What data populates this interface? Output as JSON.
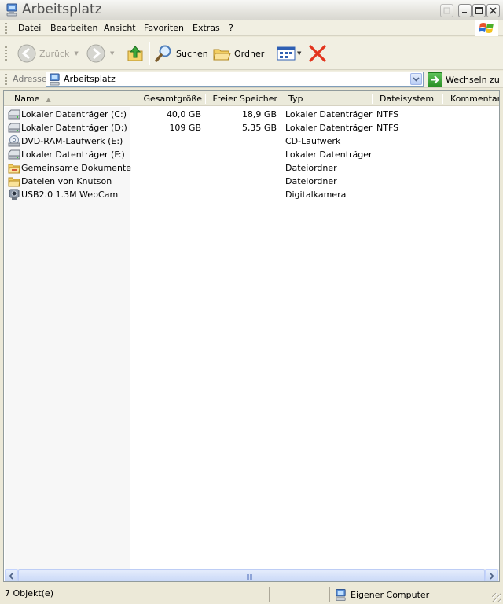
{
  "window": {
    "title": "Arbeitsplatz"
  },
  "menu": {
    "items": [
      {
        "label": "Datei"
      },
      {
        "label": "Bearbeiten"
      },
      {
        "label": "Ansicht"
      },
      {
        "label": "Favoriten"
      },
      {
        "label": "Extras"
      },
      {
        "label": "?"
      }
    ]
  },
  "toolbar": {
    "back_label": "Zurück",
    "search_label": "Suchen",
    "folders_label": "Ordner"
  },
  "address": {
    "label": "Adresse",
    "value": "Arbeitsplatz",
    "go_label": "Wechseln zu"
  },
  "list": {
    "columns": [
      {
        "label": "Name"
      },
      {
        "label": "Gesamtgröße"
      },
      {
        "label": "Freier Speicher"
      },
      {
        "label": "Typ"
      },
      {
        "label": "Dateisystem"
      },
      {
        "label": "Kommentare"
      }
    ],
    "rows": [
      {
        "name": "Lokaler Datenträger (C:)",
        "size": "40,0 GB",
        "free": "18,9 GB",
        "type": "Lokaler Datenträger",
        "fs": "NTFS",
        "icon": "drive-icon"
      },
      {
        "name": "Lokaler Datenträger (D:)",
        "size": "109 GB",
        "free": "5,35 GB",
        "type": "Lokaler Datenträger",
        "fs": "NTFS",
        "icon": "drive-icon"
      },
      {
        "name": "DVD-RAM-Laufwerk (E:)",
        "size": "",
        "free": "",
        "type": "CD-Laufwerk",
        "fs": "",
        "icon": "dvd-drive-icon"
      },
      {
        "name": "Lokaler Datenträger (F:)",
        "size": "",
        "free": "",
        "type": "Lokaler Datenträger",
        "fs": "",
        "icon": "drive-icon"
      },
      {
        "name": "Gemeinsame Dokumente",
        "size": "",
        "free": "",
        "type": "Dateiordner",
        "fs": "",
        "icon": "shared-folder-icon"
      },
      {
        "name": "Dateien von Knutson",
        "size": "",
        "free": "",
        "type": "Dateiordner",
        "fs": "",
        "icon": "folder-icon"
      },
      {
        "name": "USB2.0 1.3M WebCam",
        "size": "",
        "free": "",
        "type": "Digitalkamera",
        "fs": "",
        "icon": "webcam-icon"
      }
    ]
  },
  "status": {
    "count": "7 Objekt(e)",
    "zone": "Eigener Computer"
  },
  "colors": {
    "window_bg": "#ece9d8",
    "toolbar_bg": "#f1efe2",
    "sorted_column_bg": "#f7f7f7",
    "close_x_red": "#e3341d"
  }
}
